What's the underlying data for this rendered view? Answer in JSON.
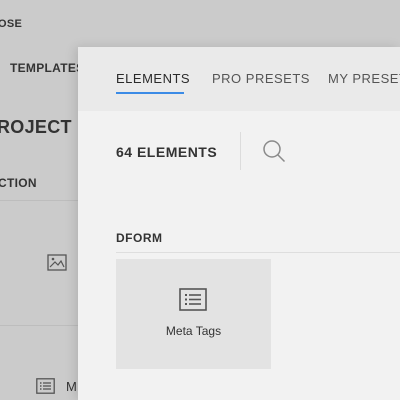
{
  "background_editor": {
    "close_label": "OSE",
    "templates_label": "TEMPLATES",
    "project_title": "ROJECT D",
    "section_label": "CTION",
    "list_item_label": "M",
    "icons": [
      "image-icon",
      "list-icon"
    ]
  },
  "modal": {
    "tabs": [
      {
        "label": "ELEMENTS",
        "active": true
      },
      {
        "label": "PRO PRESETS",
        "active": false
      },
      {
        "label": "MY PRESETS",
        "active": false
      }
    ],
    "element_count_label": "64 ELEMENTS",
    "search_icon": "search-icon",
    "category": {
      "title": "DFORM",
      "items": [
        {
          "label": "Meta Tags",
          "icon": "list-icon"
        }
      ]
    }
  },
  "colors": {
    "accent": "#3b8be6",
    "modal_bg": "#f2f2f2",
    "card_bg": "#e3e3e3",
    "overlay_bg": "#cbcbcb"
  }
}
